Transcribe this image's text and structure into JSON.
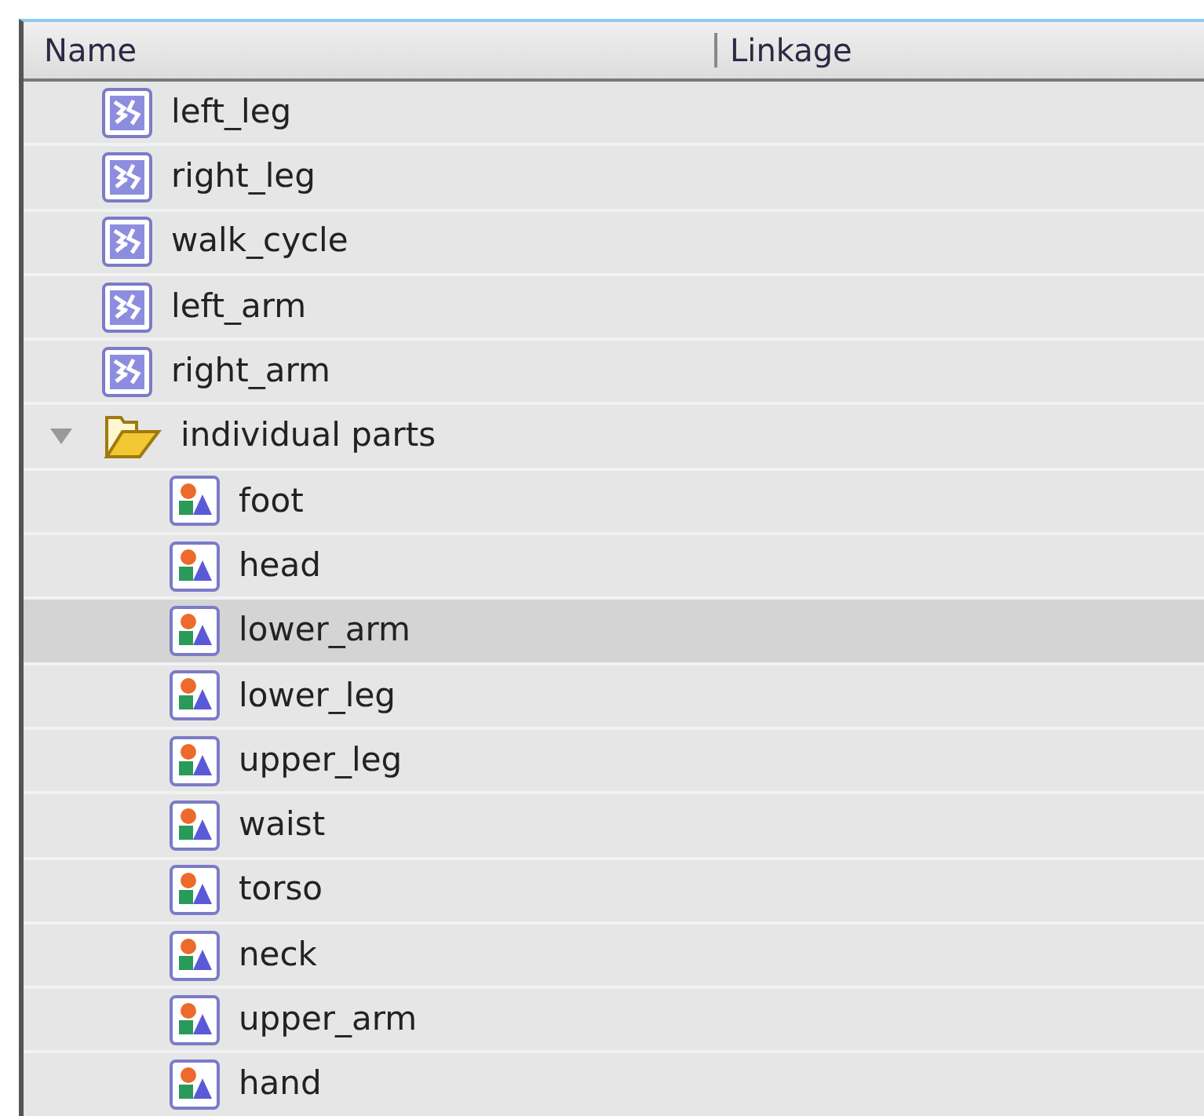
{
  "table": {
    "columns": [
      "Name",
      "Linkage"
    ],
    "items": [
      {
        "name": "left_leg",
        "kind": "symbol",
        "selected": false
      },
      {
        "name": "right_leg",
        "kind": "symbol",
        "selected": false
      },
      {
        "name": "walk_cycle",
        "kind": "symbol",
        "selected": false
      },
      {
        "name": "left_arm",
        "kind": "symbol",
        "selected": false
      },
      {
        "name": "right_arm",
        "kind": "symbol",
        "selected": false
      },
      {
        "name": "individual parts",
        "kind": "folder",
        "selected": false,
        "expanded": true,
        "children": [
          {
            "name": "foot",
            "kind": "bitmap",
            "selected": false
          },
          {
            "name": "head",
            "kind": "bitmap",
            "selected": false
          },
          {
            "name": "lower_arm",
            "kind": "bitmap",
            "selected": true
          },
          {
            "name": "lower_leg",
            "kind": "bitmap",
            "selected": false
          },
          {
            "name": "upper_leg",
            "kind": "bitmap",
            "selected": false
          },
          {
            "name": "waist",
            "kind": "bitmap",
            "selected": false
          },
          {
            "name": "torso",
            "kind": "bitmap",
            "selected": false
          },
          {
            "name": "neck",
            "kind": "bitmap",
            "selected": false
          },
          {
            "name": "upper_arm",
            "kind": "bitmap",
            "selected": false
          },
          {
            "name": "hand",
            "kind": "bitmap",
            "selected": false
          }
        ]
      }
    ]
  }
}
